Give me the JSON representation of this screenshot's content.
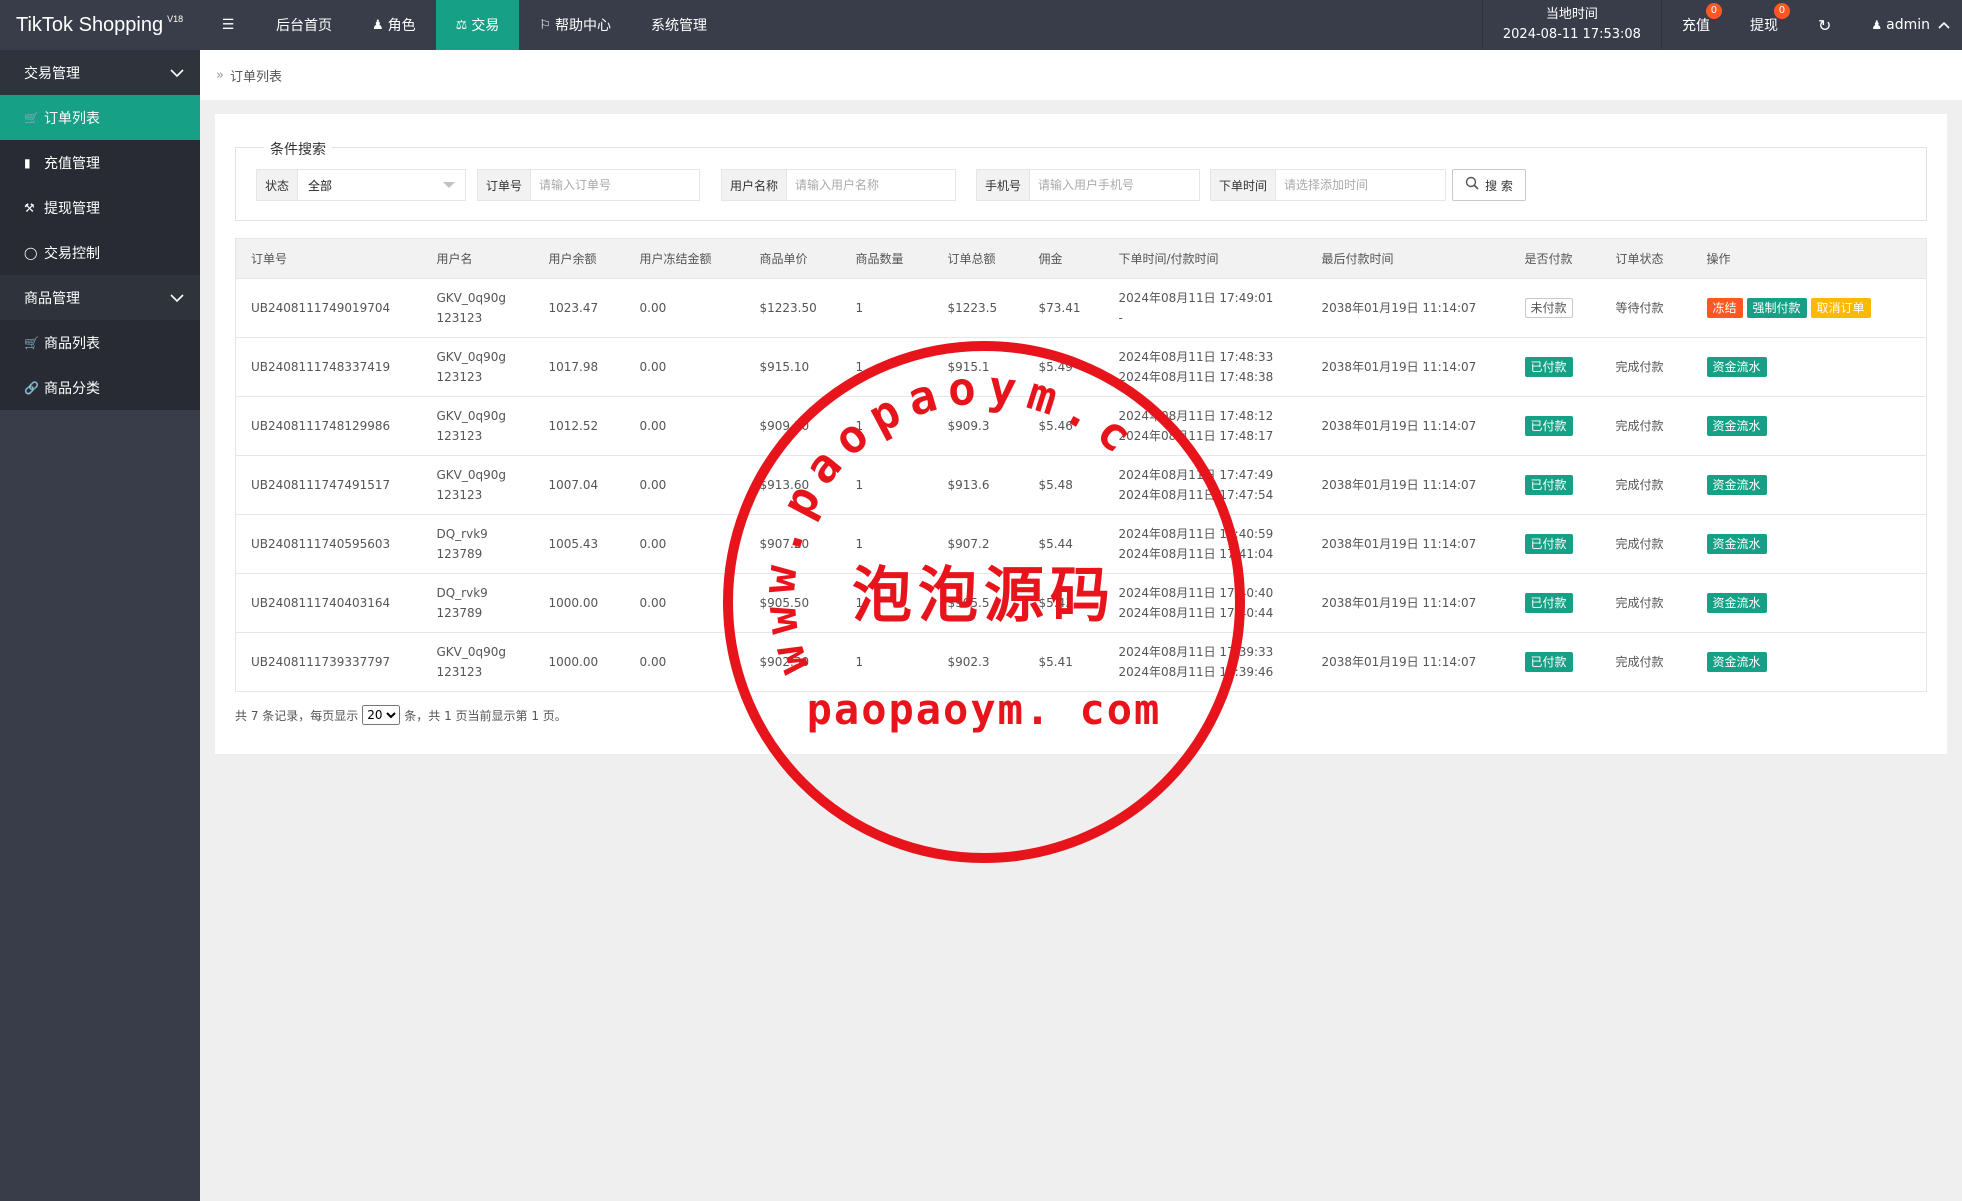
{
  "topbar": {
    "app_name": "TikTok Shopping",
    "version": "V18",
    "nav": [
      {
        "label": "后台首页"
      },
      {
        "label": "角色"
      },
      {
        "label": "交易"
      },
      {
        "label": "帮助中心"
      },
      {
        "label": "系统管理"
      }
    ],
    "time_label": "当地时间",
    "time_value": "2024-08-11 17:53:08",
    "recharge_label": "充值",
    "recharge_count": "0",
    "withdraw_label": "提现",
    "withdraw_count": "0",
    "user": "admin"
  },
  "sidebar": {
    "groups": [
      {
        "label": "交易管理",
        "items": [
          {
            "label": "订单列表"
          },
          {
            "label": "充值管理"
          },
          {
            "label": "提现管理"
          },
          {
            "label": "交易控制"
          }
        ]
      },
      {
        "label": "商品管理",
        "items": [
          {
            "label": "商品列表"
          },
          {
            "label": "商品分类"
          }
        ]
      }
    ]
  },
  "breadcrumb": "订单列表",
  "search": {
    "legend": "条件搜索",
    "status_label": "状态",
    "status_value": "全部",
    "order_label": "订单号",
    "order_placeholder": "请输入订单号",
    "username_label": "用户名称",
    "username_placeholder": "请输入用户名称",
    "phone_label": "手机号",
    "phone_placeholder": "请输入用户手机号",
    "time_label": "下单时间",
    "time_placeholder": "请选择添加时间",
    "button": "搜 索"
  },
  "table": {
    "headers": [
      "订单号",
      "用户名",
      "用户余额",
      "用户冻结金额",
      "商品单价",
      "商品数量",
      "订单总额",
      "佣金",
      "下单时间/付款时间",
      "最后付款时间",
      "是否付款",
      "订单状态",
      "操作"
    ],
    "rows": [
      {
        "order": "UB2408111749019704",
        "user1": "GKV_0q90g",
        "user2": "123123",
        "balance": "1023.47",
        "frozen": "0.00",
        "price": "$1223.50",
        "qty": "1",
        "total": "$1223.5",
        "commission": "$73.41",
        "time1": "2024年08月11日 17:49:01",
        "time2": "-",
        "last_pay": "2038年01月19日 11:14:07",
        "paid": "未付款",
        "status": "等待付款",
        "actions": [
          "冻结",
          "强制付款",
          "取消订单"
        ]
      },
      {
        "order": "UB2408111748337419",
        "user1": "GKV_0q90g",
        "user2": "123123",
        "balance": "1017.98",
        "frozen": "0.00",
        "price": "$915.10",
        "qty": "1",
        "total": "$915.1",
        "commission": "$5.49",
        "time1": "2024年08月11日 17:48:33",
        "time2": "2024年08月11日 17:48:38",
        "last_pay": "2038年01月19日 11:14:07",
        "paid": "已付款",
        "status": "完成付款",
        "actions": [
          "资金流水"
        ]
      },
      {
        "order": "UB2408111748129986",
        "user1": "GKV_0q90g",
        "user2": "123123",
        "balance": "1012.52",
        "frozen": "0.00",
        "price": "$909.30",
        "qty": "1",
        "total": "$909.3",
        "commission": "$5.46",
        "time1": "2024年08月11日 17:48:12",
        "time2": "2024年08月11日 17:48:17",
        "last_pay": "2038年01月19日 11:14:07",
        "paid": "已付款",
        "status": "完成付款",
        "actions": [
          "资金流水"
        ]
      },
      {
        "order": "UB2408111747491517",
        "user1": "GKV_0q90g",
        "user2": "123123",
        "balance": "1007.04",
        "frozen": "0.00",
        "price": "$913.60",
        "qty": "1",
        "total": "$913.6",
        "commission": "$5.48",
        "time1": "2024年08月11日 17:47:49",
        "time2": "2024年08月11日 17:47:54",
        "last_pay": "2038年01月19日 11:14:07",
        "paid": "已付款",
        "status": "完成付款",
        "actions": [
          "资金流水"
        ]
      },
      {
        "order": "UB2408111740595603",
        "user1": "DQ_rvk9",
        "user2": "123789",
        "balance": "1005.43",
        "frozen": "0.00",
        "price": "$907.20",
        "qty": "1",
        "total": "$907.2",
        "commission": "$5.44",
        "time1": "2024年08月11日 17:40:59",
        "time2": "2024年08月11日 17:41:04",
        "last_pay": "2038年01月19日 11:14:07",
        "paid": "已付款",
        "status": "完成付款",
        "actions": [
          "资金流水"
        ]
      },
      {
        "order": "UB2408111740403164",
        "user1": "DQ_rvk9",
        "user2": "123789",
        "balance": "1000.00",
        "frozen": "0.00",
        "price": "$905.50",
        "qty": "1",
        "total": "$905.5",
        "commission": "$5.43",
        "time1": "2024年08月11日 17:40:40",
        "time2": "2024年08月11日 17:40:44",
        "last_pay": "2038年01月19日 11:14:07",
        "paid": "已付款",
        "status": "完成付款",
        "actions": [
          "资金流水"
        ]
      },
      {
        "order": "UB2408111739337797",
        "user1": "GKV_0q90g",
        "user2": "123123",
        "balance": "1000.00",
        "frozen": "0.00",
        "price": "$902.30",
        "qty": "1",
        "total": "$902.3",
        "commission": "$5.41",
        "time1": "2024年08月11日 17:39:33",
        "time2": "2024年08月11日 17:39:46",
        "last_pay": "2038年01月19日 11:14:07",
        "paid": "已付款",
        "status": "完成付款",
        "actions": [
          "资金流水"
        ]
      }
    ]
  },
  "pager": {
    "prefix": "共 7 条记录，每页显示",
    "per_page": "20",
    "suffix": "条，共 1 页当前显示第 1 页。"
  },
  "watermark": {
    "arc_text": "www.paopaoym.com",
    "center_text": "泡泡源码",
    "bottom_text": "paopaoym. com",
    "color": "#e8141c"
  },
  "colors": {
    "accent": "#16a085",
    "dark": "#393d49",
    "danger": "#ff5722",
    "warn": "#ffb800"
  }
}
